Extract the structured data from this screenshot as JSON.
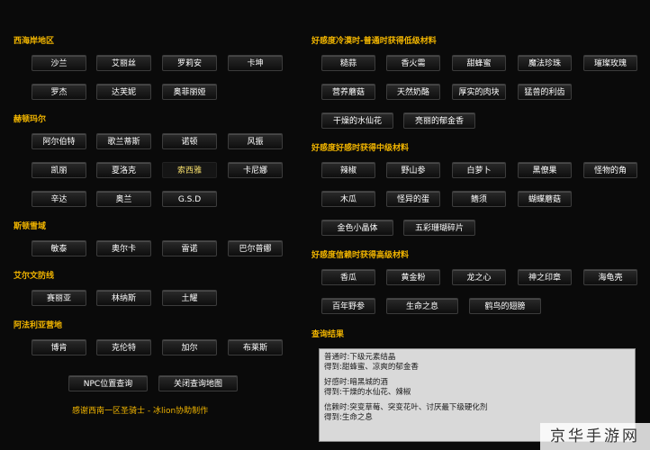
{
  "left": {
    "sections": [
      {
        "heading": "西海岸地区",
        "buttons": [
          "沙兰",
          "艾丽丝",
          "罗莉安",
          "卡坤",
          "罗杰",
          "达芙妮",
          "奥菲丽娅"
        ]
      },
      {
        "heading": "赫顿玛尔",
        "buttons": [
          "阿尔伯特",
          "歌兰蒂斯",
          "诺顿",
          "风振",
          "凯丽",
          "夏洛克",
          "索西雅",
          "卡尼娜",
          "辛达",
          "奥兰",
          "G.S.D"
        ]
      },
      {
        "heading": "斯顿雪域",
        "buttons": [
          "敏泰",
          "奥尔卡",
          "雷诺",
          "巴尔普娜"
        ]
      },
      {
        "heading": "艾尔文防线",
        "buttons": [
          "赛丽亚",
          "林纳斯",
          "土耀"
        ]
      },
      {
        "heading": "阿法利亚营地",
        "buttons": [
          "博肯",
          "克伦特",
          "加尔",
          "布莱斯"
        ]
      }
    ],
    "actions": [
      "NPC位置查询",
      "关闭查询地图"
    ],
    "credit": "感谢西南一区圣骑士 - 冰lion协助制作"
  },
  "right": {
    "sections": [
      {
        "heading": "好感度冷漠时-普通时获得低级材料",
        "buttons": [
          "糙蒜",
          "香火需",
          "甜蜂蜜",
          "魔法珍珠",
          "璀璨玫瑰",
          "营养蘑菇",
          "天然奶酪",
          "厚实的肉块",
          "猛兽的利齿",
          "干燥的水仙花",
          "亮丽的郁金香"
        ]
      },
      {
        "heading": "好感度好感时获得中级材料",
        "buttons": [
          "辣椒",
          "野山参",
          "白萝卜",
          "黑僚果",
          "怪物的角",
          "木瓜",
          "怪异的蛋",
          "鳍须",
          "蝴蝶蘑菇",
          "金色小晶体",
          "五彩珊瑚碎片"
        ]
      },
      {
        "heading": "好感度信赖时获得高级材料",
        "buttons": [
          "香瓜",
          "黄金粉",
          "龙之心",
          "神之印章",
          "海龟壳",
          "百年野参",
          "生命之息",
          "鹤鸟的翅膀"
        ]
      }
    ],
    "results_heading": "查询结果",
    "results": [
      "普通时:下级元素结晶",
      "得到:甜蜂蜜、凉爽的郁金香",
      "",
      "好感时:暗黑城的酒",
      "得到:干燥的水仙花、辣椒",
      "",
      "信赖时:突变草莓、突变花叶、讨厌最下级硬化剂",
      "得到:生命之息"
    ]
  },
  "watermark": "京华手游网",
  "colors": {
    "heading": "#f0b400",
    "selected_button_text": "#f4dc6a",
    "background": "#0a0a0a"
  }
}
